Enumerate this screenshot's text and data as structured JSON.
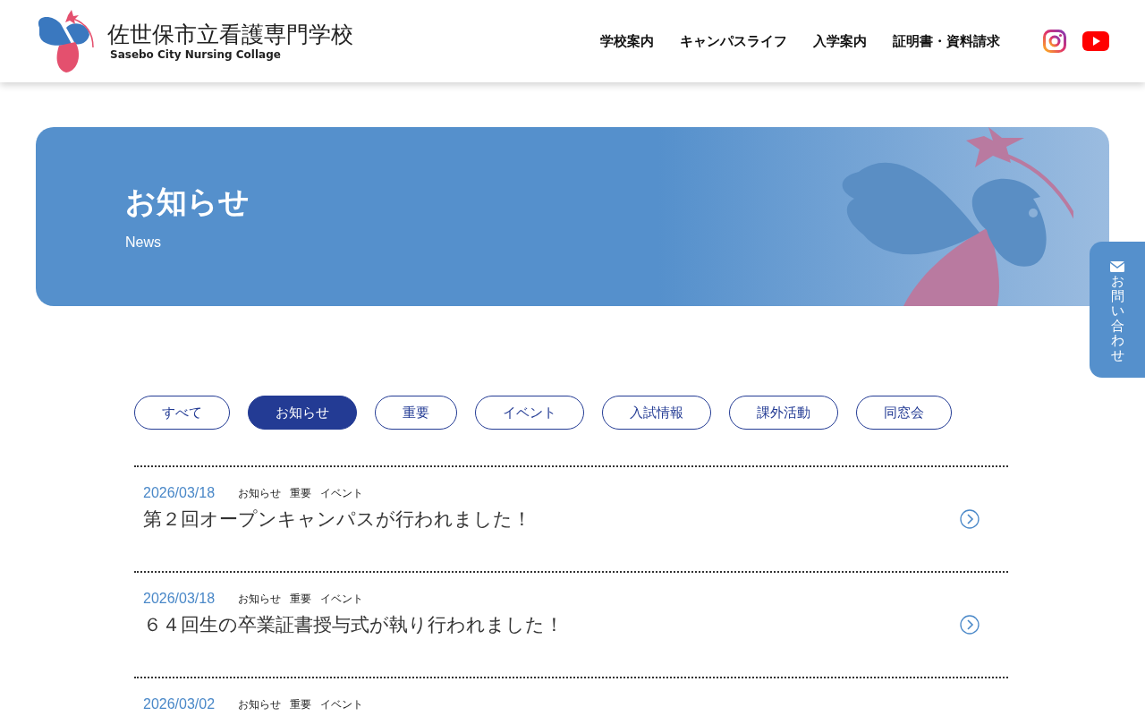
{
  "header": {
    "school_name": "佐世保市立看護専門学校",
    "school_name_en": "Sasebo City Nursing Collage",
    "nav": [
      "学校案内",
      "キャンパスライフ",
      "入学案内",
      "証明書・資料請求"
    ]
  },
  "hero": {
    "title": "お知らせ",
    "subtitle": "News"
  },
  "contact_tab": {
    "label": "お問い合わせ"
  },
  "filters": [
    {
      "label": "すべて",
      "selected": false
    },
    {
      "label": "お知らせ",
      "selected": true
    },
    {
      "label": "重要",
      "selected": false
    },
    {
      "label": "イベント",
      "selected": false
    },
    {
      "label": "入試情報",
      "selected": false
    },
    {
      "label": "課外活動",
      "selected": false
    },
    {
      "label": "同窓会",
      "selected": false
    }
  ],
  "news": [
    {
      "date": "2026/03/18",
      "tags": [
        "お知らせ",
        "重要",
        "イベント"
      ],
      "title": "第２回オープンキャンパスが行われました！"
    },
    {
      "date": "2026/03/18",
      "tags": [
        "お知らせ",
        "重要",
        "イベント"
      ],
      "title": "６４回生の卒業証書授与式が執り行われました！"
    },
    {
      "date": "2026/03/02",
      "tags": [
        "お知らせ",
        "重要",
        "イベント"
      ]
    }
  ]
}
